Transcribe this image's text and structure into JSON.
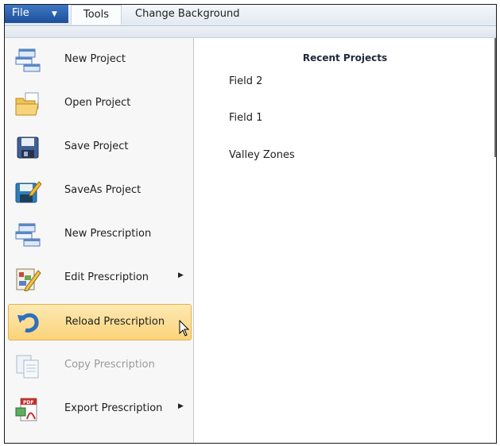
{
  "tabs": {
    "file": "File",
    "tools": "Tools",
    "change_background": "Change Background"
  },
  "menu": {
    "items": [
      {
        "label": "New Project",
        "icon": "new-project-icon"
      },
      {
        "label": "Open Project",
        "icon": "folder-icon"
      },
      {
        "label": "Save Project",
        "icon": "floppy-disk-icon"
      },
      {
        "label": "SaveAs Project",
        "icon": "save-as-icon"
      },
      {
        "label": "New Prescription",
        "icon": "new-prescription-icon"
      },
      {
        "label": "Edit Prescription",
        "icon": "edit-prescription-icon",
        "submenu": true
      },
      {
        "label": "Reload Prescription",
        "icon": "reload-icon",
        "highlighted": true
      },
      {
        "label": "Copy Prescription",
        "icon": "copy-icon",
        "disabled": true
      },
      {
        "label": "Export Prescription",
        "icon": "pdf-export-icon",
        "submenu": true
      }
    ]
  },
  "recent": {
    "title": "Recent Projects",
    "items": [
      "Field 2",
      "Field 1",
      "Valley Zones"
    ]
  },
  "colors": {
    "file_tab": "#2b5fae",
    "highlight": "#fbd37a",
    "highlight_border": "#e7b14c"
  }
}
